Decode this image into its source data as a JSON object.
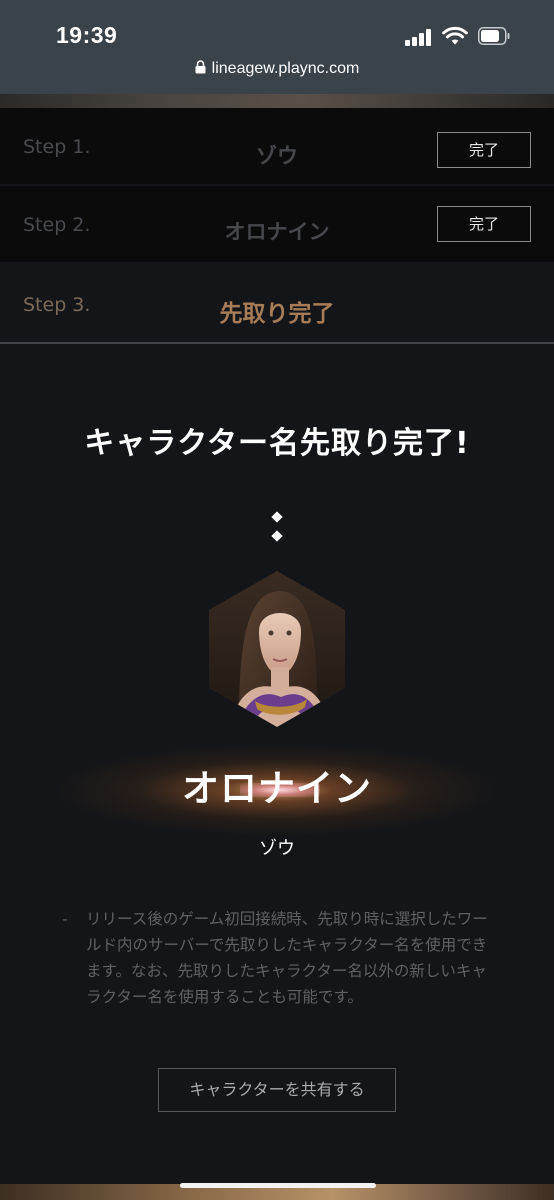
{
  "status_bar": {
    "time": "19:39",
    "url": "lineagew.plaync.com",
    "icons": [
      "signal-icon",
      "wifi-icon",
      "battery-icon",
      "lock-icon"
    ]
  },
  "steps": [
    {
      "label": "Step 1.",
      "value": "ゾウ",
      "button": "完了"
    },
    {
      "label": "Step 2.",
      "value": "オロナイン",
      "button": "完了"
    },
    {
      "label": "Step 3.",
      "value": "先取り完了"
    }
  ],
  "main": {
    "title": "キャラクター名先取り完了!",
    "character_name": "オロナイン",
    "world_name": "ゾウ",
    "notice_dash": "-",
    "notice": "リリース後のゲーム初回接続時、先取り時に選択したワールド内のサーバーで先取りしたキャラクター名を使用できます。なお、先取りしたキャラクター名以外の新しいキャラクター名を使用することも可能です。",
    "share_button": "キャラクターを共有する"
  },
  "colors": {
    "background": "#141518",
    "step_active": "#a57c57",
    "step_inactive": "#45474b",
    "status_bar": "#3a424a"
  }
}
